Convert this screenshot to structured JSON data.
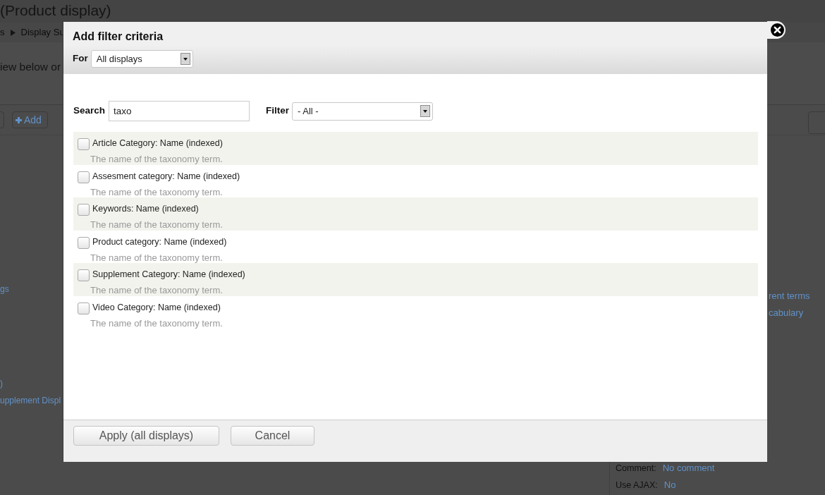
{
  "page": {
    "title": "(Product display)",
    "breadcrumb": [
      "s",
      "Display Su"
    ],
    "intro": "iew below or",
    "toolbar": {
      "add_label": "Add"
    },
    "left_links": [
      "gs",
      ")",
      "upplement Displ"
    ],
    "right_links": [
      "rent terms",
      "cabulary"
    ],
    "settings": [
      {
        "label": "Comment:",
        "value": "No comment"
      },
      {
        "label": "Use AJAX:",
        "value": "No"
      }
    ]
  },
  "dialog": {
    "title": "Add filter criteria",
    "for": {
      "label": "For",
      "value": "All displays"
    },
    "search": {
      "label": "Search",
      "value": "taxo"
    },
    "filter": {
      "label": "Filter",
      "value": "- All -"
    },
    "fields": [
      {
        "label": "Article Category: Name (indexed)",
        "description": "The name of the taxonomy term.",
        "checked": false
      },
      {
        "label": "Assesment category: Name (indexed)",
        "description": "The name of the taxonomy term.",
        "checked": false
      },
      {
        "label": "Keywords: Name (indexed)",
        "description": "The name of the taxonomy term.",
        "checked": false
      },
      {
        "label": "Product category: Name (indexed)",
        "description": "The name of the taxonomy term.",
        "checked": false
      },
      {
        "label": "Supplement Category: Name (indexed)",
        "description": "The name of the taxonomy term.",
        "checked": false
      },
      {
        "label": "Video Category: Name (indexed)",
        "description": "The name of the taxonomy term.",
        "checked": false
      }
    ],
    "buttons": [
      "Apply (all displays)",
      "Cancel"
    ]
  }
}
